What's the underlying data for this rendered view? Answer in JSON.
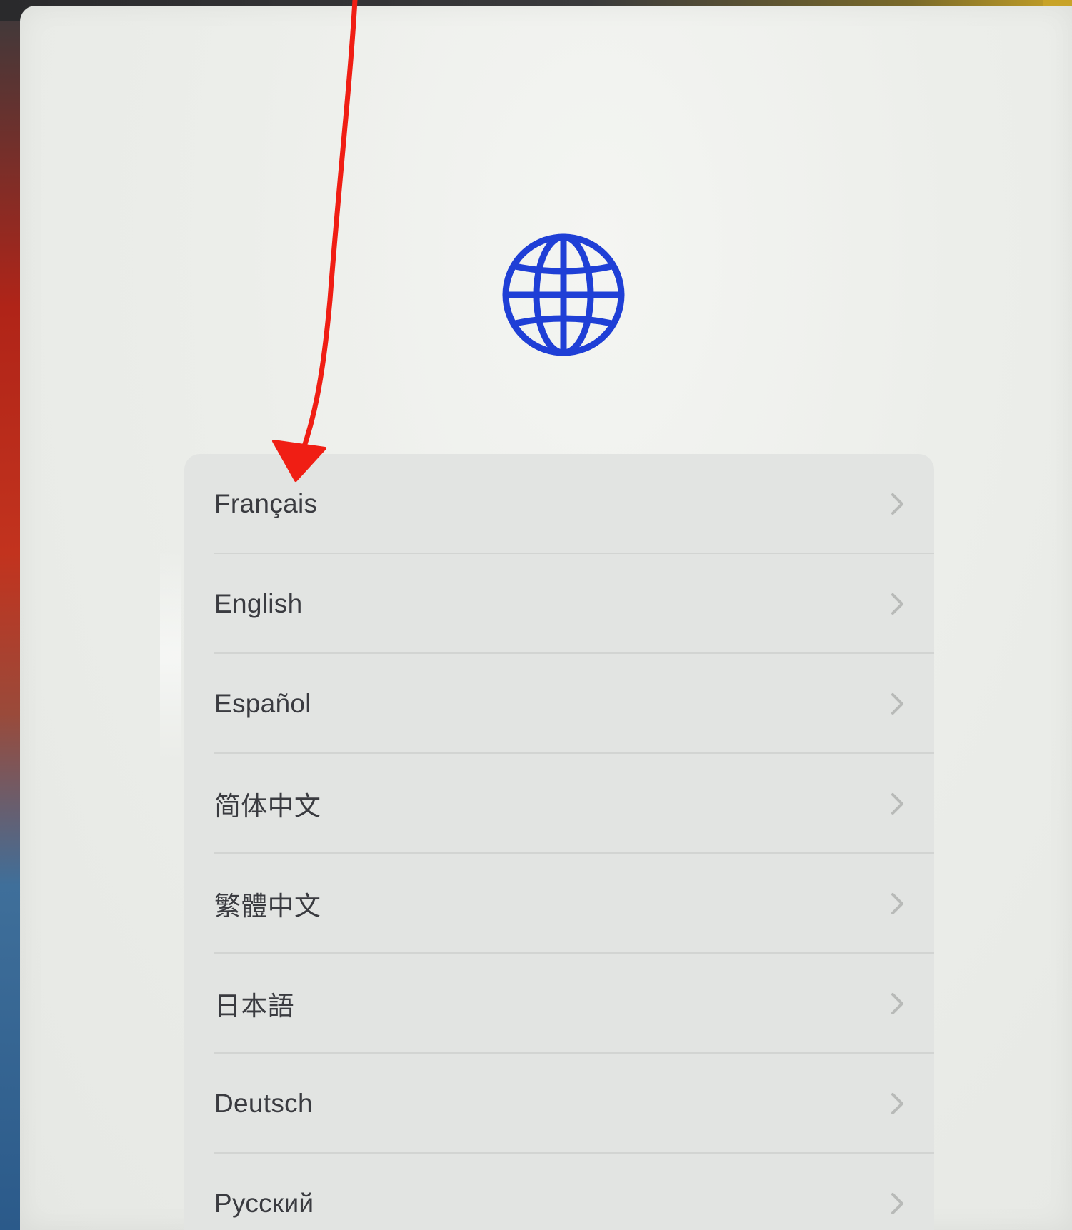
{
  "screen": {
    "icon": "globe-icon",
    "accent_color": "#1f3fd6"
  },
  "languages": [
    {
      "label": "Français",
      "icon": "chevron-right-icon"
    },
    {
      "label": "English",
      "icon": "chevron-right-icon"
    },
    {
      "label": "Español",
      "icon": "chevron-right-icon"
    },
    {
      "label": "简体中文",
      "icon": "chevron-right-icon"
    },
    {
      "label": "繁體中文",
      "icon": "chevron-right-icon"
    },
    {
      "label": "日本語",
      "icon": "chevron-right-icon"
    },
    {
      "label": "Deutsch",
      "icon": "chevron-right-icon"
    },
    {
      "label": "Русский",
      "icon": "chevron-right-icon"
    }
  ],
  "annotation": {
    "icon": "red-arrow-icon",
    "color": "#f01e14"
  }
}
